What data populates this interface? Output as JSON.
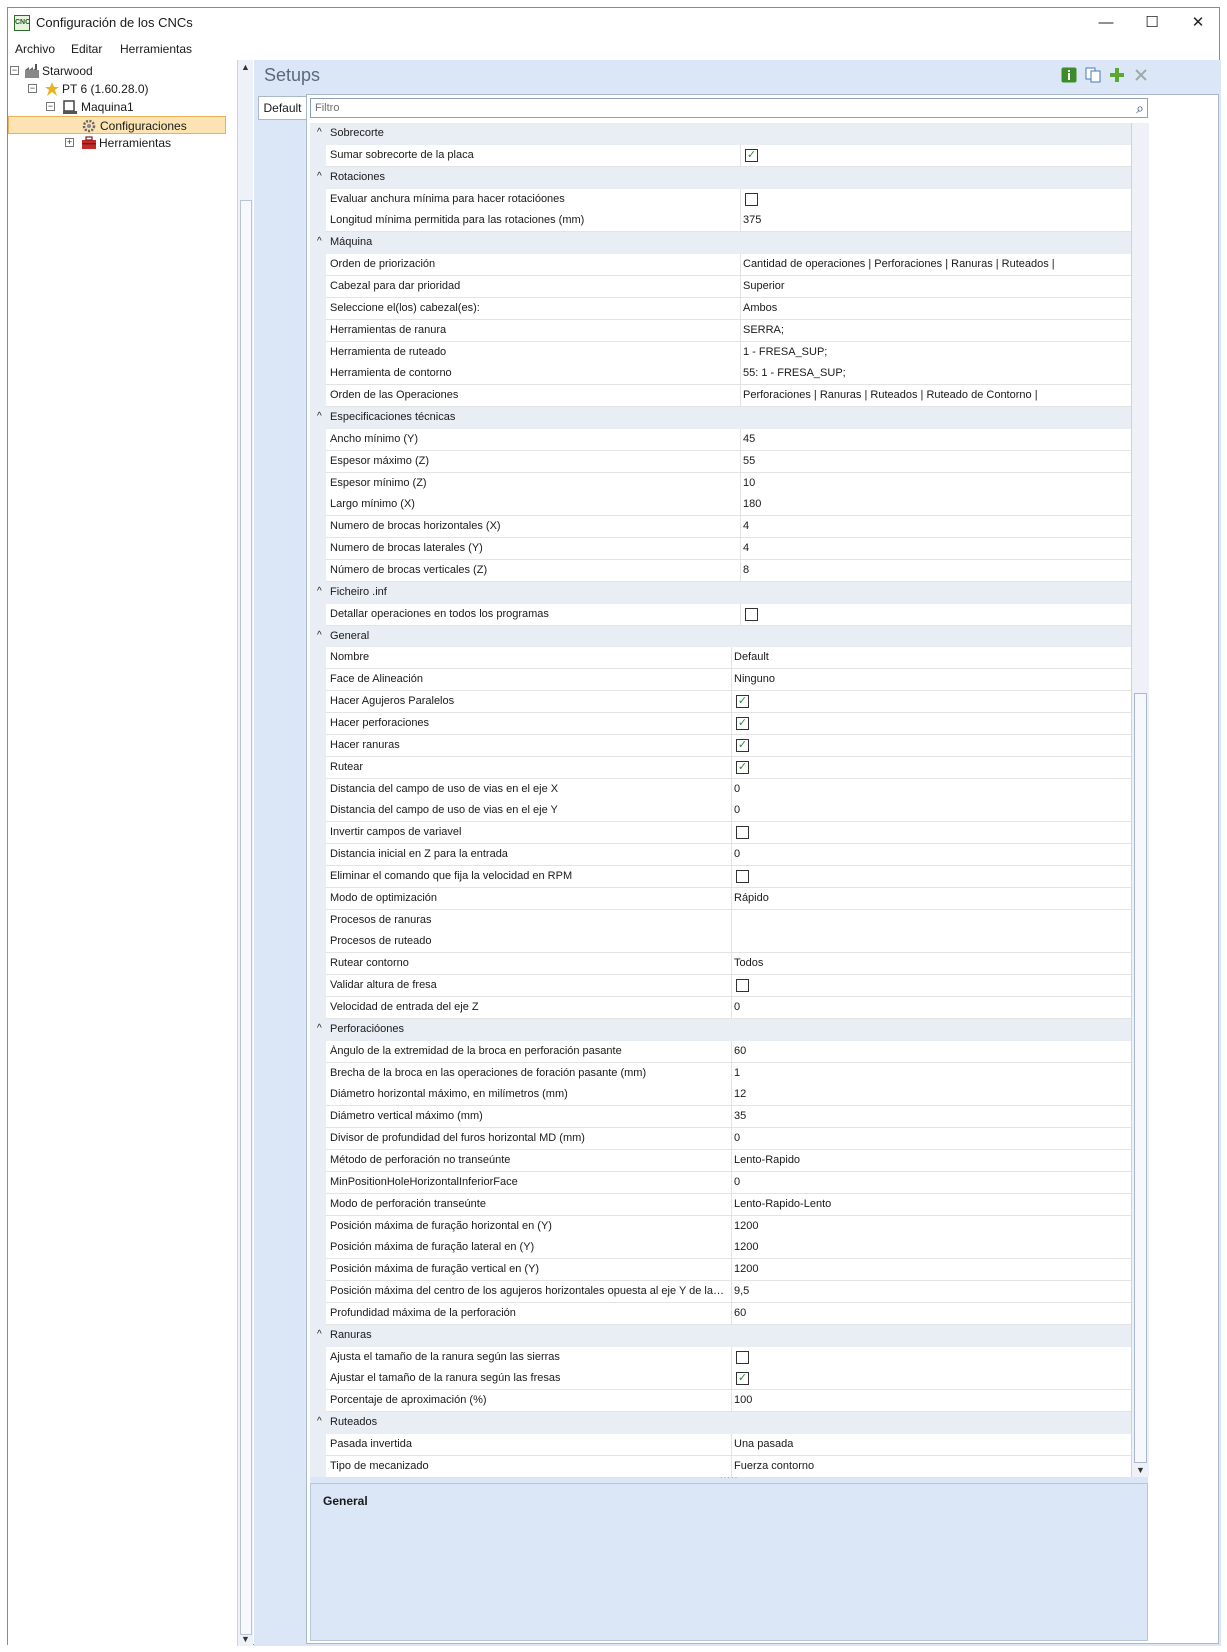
{
  "window": {
    "title": "Configuración de los CNCs",
    "icon_text": "CNC"
  },
  "controls": {
    "minimize": "—",
    "maximize": "☐",
    "close": "✕"
  },
  "menu": [
    "Archivo",
    "Editar",
    "Herramientas"
  ],
  "tree": [
    {
      "label": "Starwood",
      "expander": "−"
    },
    {
      "label": "PT 6 (1.60.28.0)",
      "expander": "−"
    },
    {
      "label": "Maquina1",
      "expander": "−"
    },
    {
      "label": "Configuraciones",
      "selected": true
    },
    {
      "label": "Herramientas",
      "expander": "+"
    }
  ],
  "panel": {
    "title": "Setups",
    "tab": "Default",
    "filter_placeholder": "Filtro"
  },
  "toolbar_icons": [
    "info-icon",
    "copy-icon",
    "add-icon",
    "delete-icon"
  ],
  "categories": [
    {
      "name": "Sobrecorte",
      "rows": [
        {
          "label": "Sumar sobrecorte de la placa",
          "check": true
        }
      ]
    },
    {
      "name": "Rotaciones",
      "rows": [
        {
          "label": "Evaluar anchura mínima para hacer rotacióones",
          "check": false
        },
        {
          "label": "Longitud mínima permitida para las rotaciones (mm)",
          "value": "375"
        }
      ]
    },
    {
      "name": "Máquina",
      "rows": [
        {
          "label": "Orden de priorización",
          "value": "Cantidad de operaciones | Perforaciones | Ranuras | Ruteados |"
        },
        {
          "label": "Cabezal para dar prioridad",
          "value": "Superior"
        },
        {
          "label": "Seleccione el(los) cabezal(es):",
          "value": "Ambos"
        },
        {
          "label": "Herramientas de ranura",
          "value": "SERRA;"
        },
        {
          "label": "Herramienta de ruteado",
          "value": "1 - FRESA_SUP;"
        },
        {
          "label": "Herramienta de contorno",
          "value": "55: 1 - FRESA_SUP;"
        },
        {
          "label": "Orden de las Operaciones",
          "value": "Perforaciones | Ranuras | Ruteados | Ruteado de Contorno |"
        }
      ]
    },
    {
      "name": "Especificaciones técnicas",
      "rows": [
        {
          "label": "Ancho mínimo (Y)",
          "value": "45"
        },
        {
          "label": "Espesor máximo (Z)",
          "value": "55"
        },
        {
          "label": "Espesor mínimo (Z)",
          "value": "10"
        },
        {
          "label": "Largo mínimo (X)",
          "value": "180"
        },
        {
          "label": "Numero de brocas horizontales (X)",
          "value": "4"
        },
        {
          "label": "Numero de brocas laterales (Y)",
          "value": "4"
        },
        {
          "label": "Número de brocas verticales (Z)",
          "value": "8"
        }
      ]
    },
    {
      "name": "Ficheiro .inf",
      "rows": [
        {
          "label": "Detallar operaciones en todos los programas",
          "check": false
        }
      ]
    },
    {
      "name": "General",
      "rows": [
        {
          "label": "Nombre",
          "value": "Default"
        },
        {
          "label": "Face de Alineación",
          "value": "Ninguno"
        },
        {
          "label": "Hacer Agujeros Paralelos",
          "check": true
        },
        {
          "label": "Hacer perforaciones",
          "check": true
        },
        {
          "label": "Hacer ranuras",
          "check": true
        },
        {
          "label": "Rutear",
          "check": true
        },
        {
          "label": "Distancia del campo de uso de vias en el eje X",
          "value": "0"
        },
        {
          "label": "Distancia del campo de uso de vias en el eje Y",
          "value": "0"
        },
        {
          "label": "Invertir campos de variavel",
          "check": false
        },
        {
          "label": "Distancia inicial en Z para la entrada",
          "value": "0"
        },
        {
          "label": "Eliminar el comando que fija la velocidad en RPM",
          "check": false
        },
        {
          "label": "Modo de optimización",
          "value": "Rápido"
        },
        {
          "label": "Procesos de ranuras",
          "value": ""
        },
        {
          "label": "Procesos de ruteado",
          "value": ""
        },
        {
          "label": "Rutear contorno",
          "value": "Todos"
        },
        {
          "label": "Validar altura de fresa",
          "check": false
        },
        {
          "label": "Velocidad de entrada del eje Z",
          "value": "0"
        }
      ]
    },
    {
      "name": "Perforacióones",
      "rows": [
        {
          "label": "Ángulo de la extremidad de la broca en perforación pasante",
          "value": "60"
        },
        {
          "label": "Brecha de la broca en las operaciones de foración pasante (mm)",
          "value": "1"
        },
        {
          "label": "Diámetro horizontal máximo, en milímetros (mm)",
          "value": "12"
        },
        {
          "label": "Diámetro vertical máximo (mm)",
          "value": "35"
        },
        {
          "label": "Divisor de profundidad del furos horizontal MD (mm)",
          "value": "0"
        },
        {
          "label": "Método de perforación no transeúnte",
          "value": "Lento-Rapido"
        },
        {
          "label": "MinPositionHoleHorizontalInferiorFace",
          "value": "0"
        },
        {
          "label": "Modo de perforación transeúnte",
          "value": "Lento-Rapido-Lento"
        },
        {
          "label": "Posición máxima de furação horizontal en (Y)",
          "value": "1200"
        },
        {
          "label": "Posición máxima de furação lateral en (Y)",
          "value": "1200"
        },
        {
          "label": "Posición máxima de furação vertical en (Y)",
          "value": "1200"
        },
        {
          "label": "Posición máxima del centro de los agujeros horizontales opuesta al eje Y de la car...",
          "value": "9,5"
        },
        {
          "label": "Profundidad máxima de la perforación",
          "value": "60"
        }
      ]
    },
    {
      "name": "Ranuras",
      "rows": [
        {
          "label": "Ajusta el tamaño de la ranura según las sierras",
          "check": false
        },
        {
          "label": "Ajustar el tamaño de la ranura según las fresas",
          "check": true
        },
        {
          "label": "Porcentaje de aproximación (%)",
          "value": "100"
        }
      ]
    },
    {
      "name": "Ruteados",
      "rows": [
        {
          "label": "Pasada invertida",
          "value": "Una pasada"
        },
        {
          "label": "Tipo de mecanizado",
          "value": "Fuerza contorno"
        }
      ]
    }
  ],
  "description": {
    "title": "General"
  },
  "glyphs": {
    "caret": "^",
    "check": "✓",
    "search": "⌕"
  }
}
